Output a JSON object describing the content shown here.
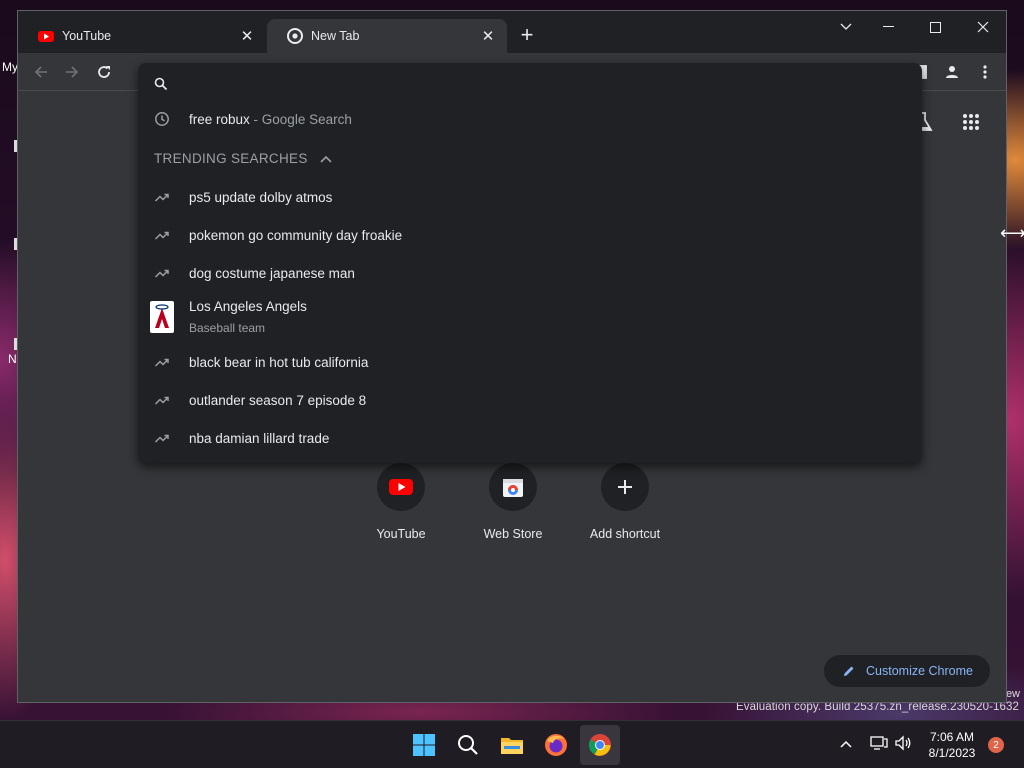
{
  "desktop": {
    "label_top": "My",
    "label_mid": "N",
    "watermark": "Evaluation copy. Build 25375.zn_release.230520-1632",
    "corner_text": "ew"
  },
  "tabs": [
    {
      "title": "YouTube",
      "favicon": "youtube-icon",
      "active": false
    },
    {
      "title": "New Tab",
      "favicon": "chrome-icon",
      "active": true
    }
  ],
  "window_controls": [
    "tab-search-chevron",
    "minimize",
    "maximize",
    "close"
  ],
  "omnibox": {
    "value": "",
    "history_suggestion": {
      "text": "free robux",
      "suffix": " - Google Search"
    },
    "trending_header": "TRENDING SEARCHES",
    "trending": [
      {
        "text": "ps5 update dolby atmos"
      },
      {
        "text": "pokemon go community day froakie"
      },
      {
        "text": "dog costume japanese man"
      },
      {
        "text": "Los Angeles Angels",
        "sub": "Baseball team",
        "entity": true
      },
      {
        "text": "black bear in hot tub california"
      },
      {
        "text": "outlander season 7 episode 8"
      },
      {
        "text": "nba damian lillard trade"
      }
    ]
  },
  "shortcuts": [
    {
      "label": "YouTube",
      "icon": "youtube-icon"
    },
    {
      "label": "Web Store",
      "icon": "web-store-icon"
    },
    {
      "label": "Add shortcut",
      "icon": "plus-icon"
    }
  ],
  "customize_label": "Customize Chrome",
  "taskbar": {
    "time": "7:06 AM",
    "date": "8/1/2023",
    "notification_count": "2"
  },
  "colors": {
    "window_bg": "#35363a",
    "dropdown_bg": "#202124",
    "accent_blue": "#8ab4f8",
    "youtube_red": "#ff0000"
  }
}
